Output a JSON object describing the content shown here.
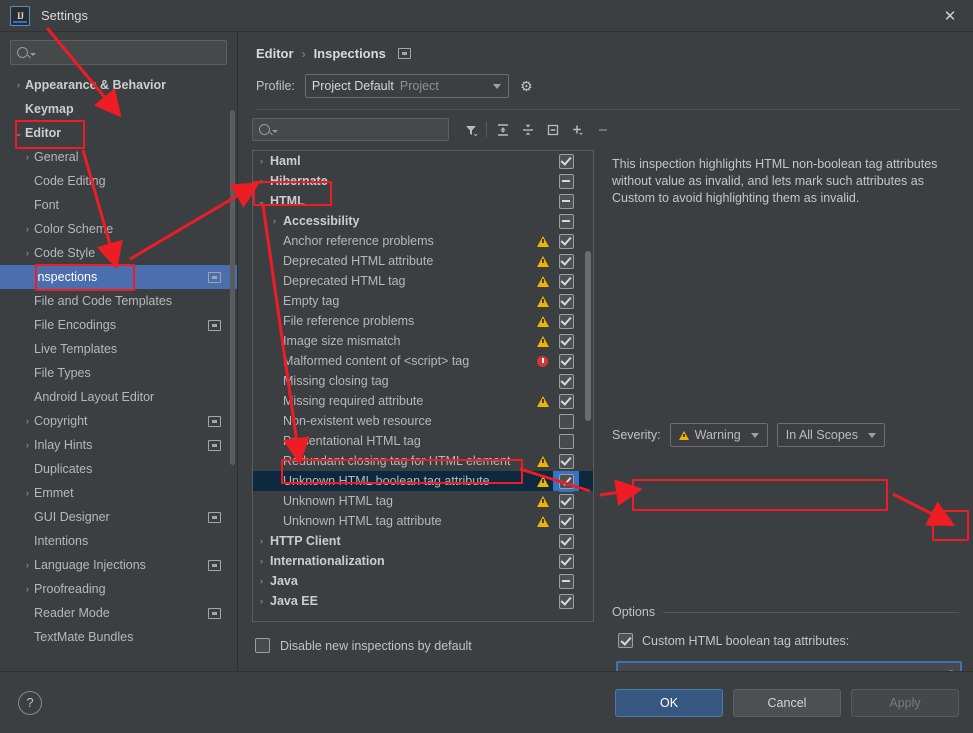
{
  "window": {
    "title": "Settings",
    "logo_text": "IJ",
    "close_label": "✕"
  },
  "sidebar": {
    "search_placeholder": "",
    "items": [
      {
        "label": "Appearance & Behavior",
        "level": 1,
        "arrow": "›",
        "selected": false,
        "cfg": false
      },
      {
        "label": "Keymap",
        "level": 1,
        "arrow": "",
        "selected": false,
        "cfg": false
      },
      {
        "label": "Editor",
        "level": 1,
        "arrow": "⌄",
        "selected": false,
        "cfg": false
      },
      {
        "label": "General",
        "level": 2,
        "arrow": "›",
        "selected": false,
        "cfg": false
      },
      {
        "label": "Code Editing",
        "level": 2,
        "arrow": "",
        "selected": false,
        "cfg": false
      },
      {
        "label": "Font",
        "level": 2,
        "arrow": "",
        "selected": false,
        "cfg": false
      },
      {
        "label": "Color Scheme",
        "level": 2,
        "arrow": "›",
        "selected": false,
        "cfg": false
      },
      {
        "label": "Code Style",
        "level": 2,
        "arrow": "›",
        "selected": false,
        "cfg": false
      },
      {
        "label": "Inspections",
        "level": 2,
        "arrow": "",
        "selected": true,
        "cfg": true
      },
      {
        "label": "File and Code Templates",
        "level": 2,
        "arrow": "",
        "selected": false,
        "cfg": false
      },
      {
        "label": "File Encodings",
        "level": 2,
        "arrow": "",
        "selected": false,
        "cfg": true
      },
      {
        "label": "Live Templates",
        "level": 2,
        "arrow": "",
        "selected": false,
        "cfg": false
      },
      {
        "label": "File Types",
        "level": 2,
        "arrow": "",
        "selected": false,
        "cfg": false
      },
      {
        "label": "Android Layout Editor",
        "level": 2,
        "arrow": "",
        "selected": false,
        "cfg": false
      },
      {
        "label": "Copyright",
        "level": 2,
        "arrow": "›",
        "selected": false,
        "cfg": true
      },
      {
        "label": "Inlay Hints",
        "level": 2,
        "arrow": "›",
        "selected": false,
        "cfg": true
      },
      {
        "label": "Duplicates",
        "level": 2,
        "arrow": "",
        "selected": false,
        "cfg": false
      },
      {
        "label": "Emmet",
        "level": 2,
        "arrow": "›",
        "selected": false,
        "cfg": false
      },
      {
        "label": "GUI Designer",
        "level": 2,
        "arrow": "",
        "selected": false,
        "cfg": true
      },
      {
        "label": "Intentions",
        "level": 2,
        "arrow": "",
        "selected": false,
        "cfg": false
      },
      {
        "label": "Language Injections",
        "level": 2,
        "arrow": "›",
        "selected": false,
        "cfg": true
      },
      {
        "label": "Proofreading",
        "level": 2,
        "arrow": "›",
        "selected": false,
        "cfg": false
      },
      {
        "label": "Reader Mode",
        "level": 2,
        "arrow": "",
        "selected": false,
        "cfg": true
      },
      {
        "label": "TextMate Bundles",
        "level": 2,
        "arrow": "",
        "selected": false,
        "cfg": false
      }
    ]
  },
  "main": {
    "breadcrumb": {
      "parent": "Editor",
      "separator": "›",
      "current": "Inspections"
    },
    "profile": {
      "label": "Profile:",
      "value": "Project Default",
      "scope": "Project",
      "gear_icon": "⚙"
    },
    "toolbar": {
      "search_placeholder": "",
      "buttons": [
        {
          "name": "filter-icon",
          "glyph": "filter"
        },
        {
          "name": "expand-all-icon",
          "glyph": "expand"
        },
        {
          "name": "collapse-all-icon",
          "glyph": "collapse"
        },
        {
          "name": "reset-icon",
          "glyph": "resetbox"
        },
        {
          "name": "add-icon",
          "glyph": "plus"
        },
        {
          "name": "remove-icon",
          "glyph": "minus"
        }
      ]
    },
    "disable_new_inspections": {
      "label": "Disable new inspections by default",
      "checked": false
    }
  },
  "inspection_tree": [
    {
      "label": "Haml",
      "level": 1,
      "group": true,
      "arrow": "›",
      "severity": "",
      "check": "checked",
      "selected": false
    },
    {
      "label": "Hibernate",
      "level": 1,
      "group": true,
      "arrow": "›",
      "severity": "",
      "check": "partial",
      "selected": false
    },
    {
      "label": "HTML",
      "level": 1,
      "group": true,
      "arrow": "⌄",
      "severity": "",
      "check": "partial",
      "selected": false
    },
    {
      "label": "Accessibility",
      "level": 2,
      "group": true,
      "arrow": "›",
      "severity": "",
      "check": "partial",
      "selected": false
    },
    {
      "label": "Anchor reference problems",
      "level": 2,
      "group": false,
      "arrow": "",
      "severity": "warning",
      "check": "checked",
      "selected": false
    },
    {
      "label": "Deprecated HTML attribute",
      "level": 2,
      "group": false,
      "arrow": "",
      "severity": "warning",
      "check": "checked",
      "selected": false
    },
    {
      "label": "Deprecated HTML tag",
      "level": 2,
      "group": false,
      "arrow": "",
      "severity": "warning",
      "check": "checked",
      "selected": false
    },
    {
      "label": "Empty tag",
      "level": 2,
      "group": false,
      "arrow": "",
      "severity": "warning",
      "check": "checked",
      "selected": false
    },
    {
      "label": "File reference problems",
      "level": 2,
      "group": false,
      "arrow": "",
      "severity": "warning",
      "check": "checked",
      "selected": false
    },
    {
      "label": "Image size mismatch",
      "level": 2,
      "group": false,
      "arrow": "",
      "severity": "warning",
      "check": "checked",
      "selected": false
    },
    {
      "label": "Malformed content of <script> tag",
      "level": 2,
      "group": false,
      "arrow": "",
      "severity": "error",
      "check": "checked",
      "selected": false
    },
    {
      "label": "Missing closing tag",
      "level": 2,
      "group": false,
      "arrow": "",
      "severity": "",
      "check": "checked",
      "selected": false
    },
    {
      "label": "Missing required attribute",
      "level": 2,
      "group": false,
      "arrow": "",
      "severity": "warning",
      "check": "checked",
      "selected": false
    },
    {
      "label": "Non-existent web resource",
      "level": 2,
      "group": false,
      "arrow": "",
      "severity": "",
      "check": "empty",
      "selected": false
    },
    {
      "label": "Presentational HTML tag",
      "level": 2,
      "group": false,
      "arrow": "",
      "severity": "",
      "check": "empty",
      "selected": false
    },
    {
      "label": "Redundant closing tag for HTML element",
      "level": 2,
      "group": false,
      "arrow": "",
      "severity": "warning",
      "check": "checked",
      "selected": false
    },
    {
      "label": "Unknown HTML boolean tag attribute",
      "level": 2,
      "group": false,
      "arrow": "",
      "severity": "warning",
      "check": "checked",
      "selected": true
    },
    {
      "label": "Unknown HTML tag",
      "level": 2,
      "group": false,
      "arrow": "",
      "severity": "warning",
      "check": "checked",
      "selected": false
    },
    {
      "label": "Unknown HTML tag attribute",
      "level": 2,
      "group": false,
      "arrow": "",
      "severity": "warning",
      "check": "checked",
      "selected": false
    },
    {
      "label": "HTTP Client",
      "level": 1,
      "group": true,
      "arrow": "›",
      "severity": "",
      "check": "checked",
      "selected": false
    },
    {
      "label": "Internationalization",
      "level": 1,
      "group": true,
      "arrow": "›",
      "severity": "",
      "check": "checked",
      "selected": false
    },
    {
      "label": "Java",
      "level": 1,
      "group": true,
      "arrow": "›",
      "severity": "",
      "check": "partial",
      "selected": false
    },
    {
      "label": "Java EE",
      "level": 1,
      "group": true,
      "arrow": "›",
      "severity": "",
      "check": "checked",
      "selected": false
    }
  ],
  "details": {
    "description": "This inspection highlights HTML non-boolean tag attributes without value as invalid, and lets mark such attributes as Custom to avoid highlighting them as invalid.",
    "severity_label": "Severity:",
    "severity_value": "Warning",
    "scope_value": "In All Scopes",
    "options_title": "Options",
    "option_checkbox_label": "Custom HTML boolean tag attributes:",
    "option_checkbox_checked": true,
    "option_input_value": "",
    "expand_icon": "⤢"
  },
  "footer": {
    "help_label": "?",
    "ok_label": "OK",
    "cancel_label": "Cancel",
    "apply_label": "Apply"
  },
  "colors": {
    "background": "#3c3f41",
    "selection_blue": "#4b6eaf",
    "row_selected_navy": "#0d293f",
    "annotation_red": "#ee1c25",
    "warning_yellow": "#f0b400",
    "error_red": "#d63535",
    "primary_button": "#365880"
  }
}
